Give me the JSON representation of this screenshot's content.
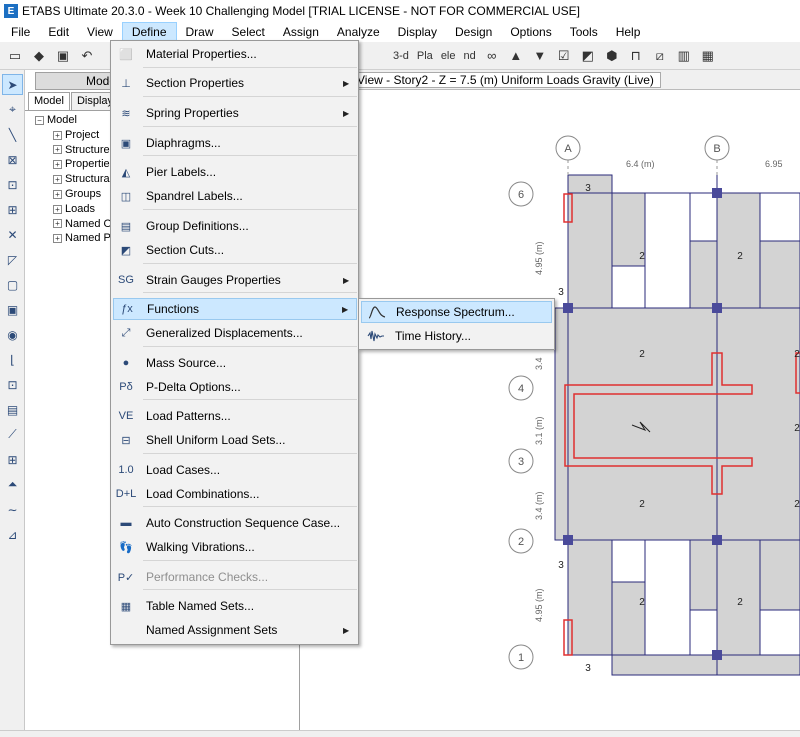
{
  "window": {
    "title": "ETABS Ultimate 20.3.0 - Week 10 Challenging Model  [TRIAL LICENSE - NOT FOR COMMERCIAL USE]"
  },
  "menubar": [
    "File",
    "Edit",
    "View",
    "Define",
    "Draw",
    "Select",
    "Assign",
    "Analyze",
    "Display",
    "Design",
    "Options",
    "Tools",
    "Help"
  ],
  "active_menu": "Define",
  "toolbar": {
    "view_3d": "3-d",
    "plan": "Pla",
    "elev": "ele",
    "nd": "nd"
  },
  "explorer": {
    "header": "Model Exp",
    "tabs": [
      "Model",
      "Display"
    ],
    "tree": [
      "Model",
      "Project",
      "Structure",
      "Properties",
      "Structural",
      "Groups",
      "Loads",
      "Named O",
      "Named Pl"
    ]
  },
  "view": {
    "title": "n View - Story2 - Z = 7.5 (m)  Uniform Loads Gravity  (Live)"
  },
  "define_menu": [
    {
      "label": "Material Properties...",
      "icon": "material-icon",
      "submenu": false
    },
    {
      "label": "Section Properties",
      "icon": "section-icon",
      "submenu": true
    },
    {
      "label": "Spring Properties",
      "icon": "spring-icon",
      "submenu": true
    },
    {
      "label": "Diaphragms...",
      "icon": "diaphragm-icon",
      "submenu": false
    },
    {
      "label": "Pier Labels...",
      "icon": "pier-icon",
      "submenu": false
    },
    {
      "label": "Spandrel Labels...",
      "icon": "spandrel-icon",
      "submenu": false
    },
    {
      "label": "Group Definitions...",
      "icon": "group-icon",
      "submenu": false
    },
    {
      "label": "Section Cuts...",
      "icon": "section-cut-icon",
      "submenu": false
    },
    {
      "label": "Strain Gauges Properties",
      "icon": "strain-gauge-icon",
      "submenu": true
    },
    {
      "label": "Functions",
      "icon": "function-icon",
      "submenu": true
    },
    {
      "label": "Generalized Displacements...",
      "icon": "displacement-icon",
      "submenu": false
    },
    {
      "label": "Mass Source...",
      "icon": "mass-icon",
      "submenu": false
    },
    {
      "label": "P-Delta Options...",
      "icon": "pdelta-icon",
      "submenu": false
    },
    {
      "label": "Load Patterns...",
      "icon": "load-pattern-icon",
      "submenu": false
    },
    {
      "label": "Shell Uniform Load Sets...",
      "icon": "shell-load-icon",
      "submenu": false
    },
    {
      "label": "Load Cases...",
      "icon": "load-case-icon",
      "submenu": false
    },
    {
      "label": "Load Combinations...",
      "icon": "load-combo-icon",
      "submenu": false
    },
    {
      "label": "Auto Construction Sequence Case...",
      "icon": "construction-icon",
      "submenu": false
    },
    {
      "label": "Walking Vibrations...",
      "icon": "footsteps-icon",
      "submenu": false
    },
    {
      "label": "Performance Checks...",
      "icon": "performance-icon",
      "submenu": false,
      "disabled": true
    },
    {
      "label": "Table Named Sets...",
      "icon": "table-icon",
      "submenu": false
    },
    {
      "label": "Named Assignment Sets",
      "icon": "assignment-icon",
      "submenu": true
    }
  ],
  "functions_submenu": [
    "Response Spectrum...",
    "Time History..."
  ],
  "grid": {
    "columns": [
      "A",
      "B"
    ],
    "rows": [
      "6",
      "4",
      "3",
      "2",
      "1"
    ],
    "dims_x": [
      "6.4 (m)",
      "6.95"
    ],
    "dims_y": [
      "4.95 (m)",
      "3.4",
      "3.1 (m)",
      "3.4 (m)",
      "4.95 (m)"
    ],
    "slab_labels": [
      "3",
      "2",
      "2",
      "3",
      "2",
      "2",
      "2",
      "2",
      "3",
      "2",
      "2",
      "3",
      "2"
    ]
  }
}
